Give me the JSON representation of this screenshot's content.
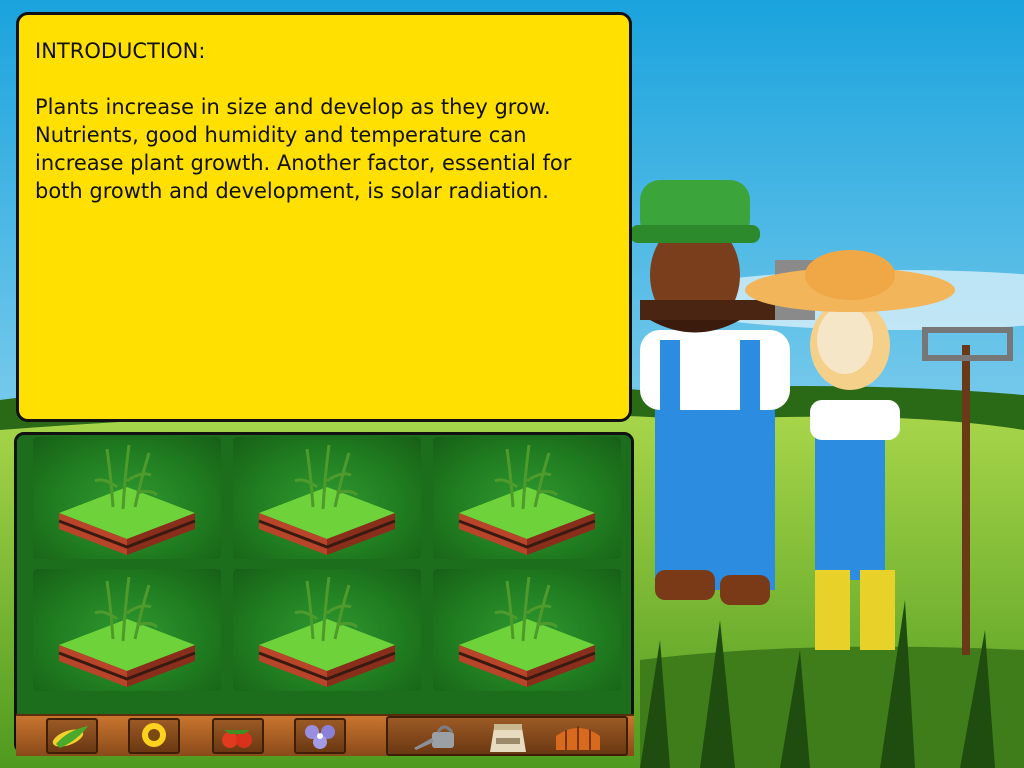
{
  "intro": {
    "heading": "INTRODUCTION:",
    "body": "Plants increase in size and develop as they grow. Nutrients, good humidity and temperature can increase plant growth. Another factor, essential for both growth and development, is solar radiation."
  },
  "garden": {
    "plots": [
      {
        "row": 1,
        "col": 1,
        "crop": "corn-seedling"
      },
      {
        "row": 1,
        "col": 2,
        "crop": "corn-seedling"
      },
      {
        "row": 1,
        "col": 3,
        "crop": "corn-seedling"
      },
      {
        "row": 2,
        "col": 1,
        "crop": "corn-seedling"
      },
      {
        "row": 2,
        "col": 2,
        "crop": "corn-seedling"
      },
      {
        "row": 2,
        "col": 3,
        "crop": "corn-seedling"
      }
    ]
  },
  "toolbar": {
    "seeds": [
      "corn-icon",
      "sunflower-icon",
      "tomato-icon",
      "violet-flower-icon"
    ],
    "tools": [
      "watering-can-icon",
      "fertilizer-bag-icon",
      "greenhouse-icon"
    ]
  },
  "colors": {
    "intro_panel": "#ffe000",
    "garden_bg": "#1c6e1c",
    "toolbar_wood": "#a85e22",
    "sky": "#7fc4e8",
    "grass": "#8cc63e"
  }
}
